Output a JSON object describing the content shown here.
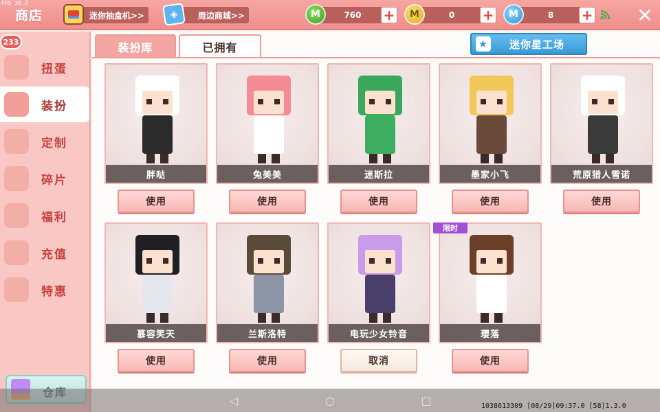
{
  "fps": "FPS 30.2",
  "header": {
    "title": "商店",
    "gacha_label": "迷你抽盒机>>",
    "mall_label": "周边商城>>",
    "currencies": [
      {
        "name": "mini-bean",
        "value": "760",
        "color": "#4caf3a"
      },
      {
        "name": "mini-coin",
        "value": "0",
        "color": "#e2b320"
      },
      {
        "name": "star-coin",
        "value": "8",
        "color": "#2f8fd4"
      }
    ]
  },
  "sidebar": {
    "badge": "233",
    "items": [
      {
        "label": "扭蛋",
        "active": false
      },
      {
        "label": "装扮",
        "active": true
      },
      {
        "label": "定制",
        "active": false
      },
      {
        "label": "碎片",
        "active": false
      },
      {
        "label": "福利",
        "active": false
      },
      {
        "label": "充值",
        "active": false
      },
      {
        "label": "特惠",
        "active": false
      }
    ],
    "warehouse_label": "仓库"
  },
  "tabs": [
    {
      "label": "装扮库",
      "active": false
    },
    {
      "label": "已拥有",
      "active": true
    }
  ],
  "workshop_label": "迷你星工场",
  "limited_label": "限时",
  "skins": [
    {
      "name": "胖哒",
      "button": "使用",
      "hair": "#ffffff",
      "outfit": "#2b2b2b"
    },
    {
      "name": "兔美美",
      "button": "使用",
      "hair": "#f48c94",
      "outfit": "#ffffff"
    },
    {
      "name": "迷斯拉",
      "button": "使用",
      "hair": "#39a85a",
      "outfit": "#3dae5f"
    },
    {
      "name": "墨家小飞",
      "button": "使用",
      "hair": "#f2c85a",
      "outfit": "#6a4a3a"
    },
    {
      "name": "荒原猎人雪诺",
      "button": "使用",
      "hair": "#ffffff",
      "outfit": "#3a3a3a"
    },
    {
      "name": "慕容笑天",
      "button": "使用",
      "hair": "#1f1f24",
      "outfit": "#e6e6ee"
    },
    {
      "name": "兰斯洛特",
      "button": "使用",
      "hair": "#5a4a3a",
      "outfit": "#8c95a5"
    },
    {
      "name": "电玩少女铃音",
      "button": "取消",
      "hair": "#c99be8",
      "outfit": "#4a3f6a"
    },
    {
      "name": "璎落",
      "button": "使用",
      "hair": "#6b3f28",
      "outfit": "#ffffff"
    }
  ],
  "nav": {
    "back": "◁",
    "home": "○",
    "recent": "□"
  },
  "status_line": "1038613309  [08/29]09:37.0 [58]1.3.0"
}
